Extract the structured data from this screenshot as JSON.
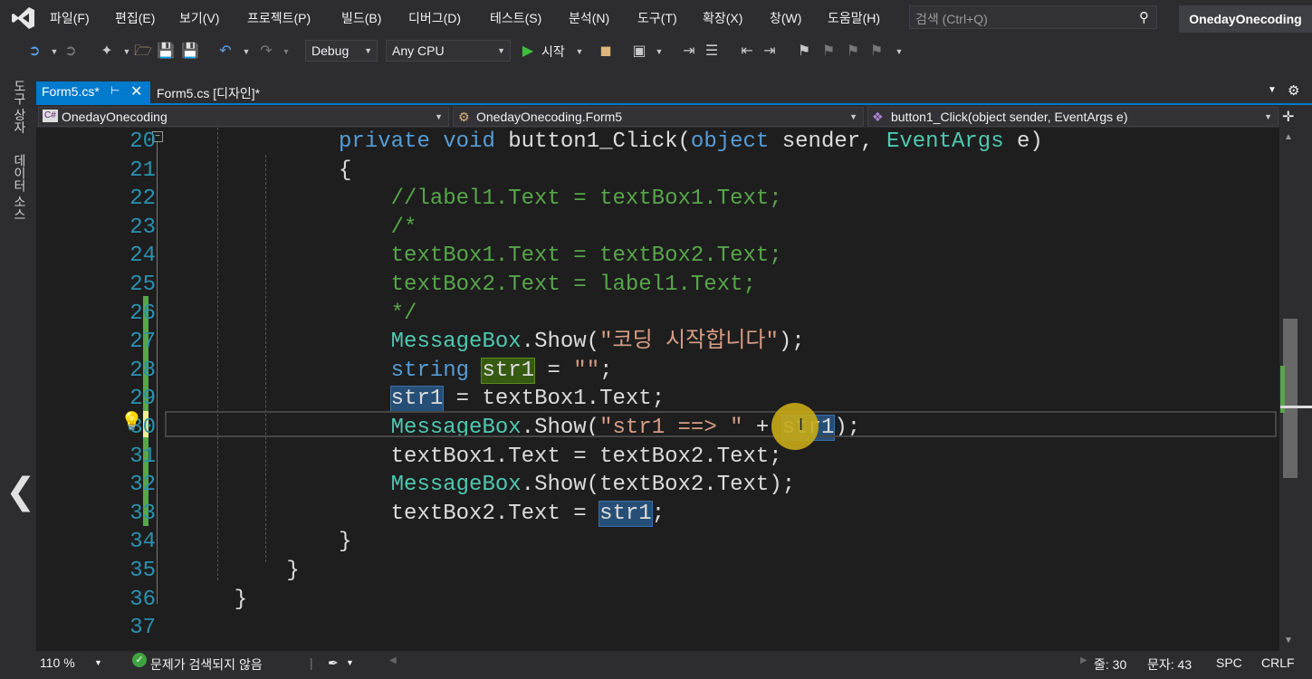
{
  "menubar": {
    "items": [
      "파일(F)",
      "편집(E)",
      "보기(V)",
      "프로젝트(P)",
      "빌드(B)",
      "디버그(D)",
      "테스트(S)",
      "분석(N)",
      "도구(T)",
      "확장(X)",
      "창(W)",
      "도움말(H)"
    ],
    "search_placeholder": "검색 (Ctrl+Q)",
    "account": "OnedayOnecoding"
  },
  "toolbar": {
    "config": "Debug",
    "platform": "Any CPU",
    "start_label": "시작"
  },
  "left_panels": [
    "도구 상자",
    "데이터 소스"
  ],
  "tabs": [
    {
      "label": "Form5.cs*",
      "active": true
    },
    {
      "label": "Form5.cs [디자인]*",
      "active": false
    }
  ],
  "nav": {
    "project": "OnedayOnecoding",
    "class": "OnedayOnecoding.Form5",
    "member": "button1_Click(object sender, EventArgs e)"
  },
  "editor": {
    "line_numbers": [
      "20",
      "21",
      "22",
      "23",
      "24",
      "25",
      "26",
      "27",
      "28",
      "29",
      "30",
      "31",
      "32",
      "33",
      "34",
      "35",
      "36",
      "37"
    ],
    "current_line": 30
  },
  "status": {
    "zoom": "110 %",
    "problems": "문제가 검색되지 않음",
    "line": "줄: 30",
    "col": "문자: 43",
    "spc": "SPC",
    "eol": "CRLF"
  },
  "colors": {
    "accent": "#007acc",
    "editor_bg": "#1e1e1e",
    "keyword": "#569cd6",
    "type": "#4ec9b0",
    "comment": "#57a64a",
    "string": "#d69d85",
    "line_number": "#2b91af"
  }
}
